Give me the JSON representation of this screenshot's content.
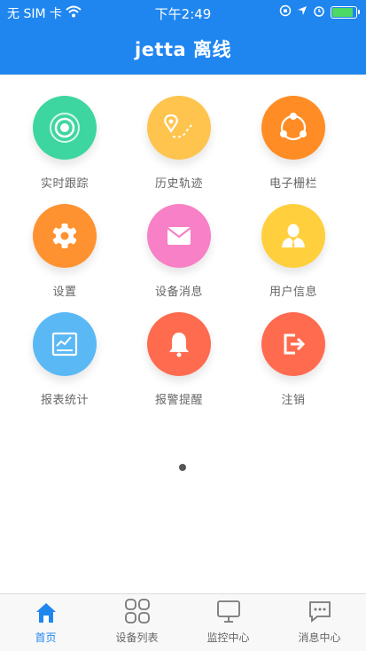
{
  "status_bar": {
    "carrier": "无 SIM 卡",
    "time": "下午2:49"
  },
  "header": {
    "title": "jetta 离线"
  },
  "menu": {
    "items": [
      {
        "label": "实时跟踪",
        "icon": "target-icon",
        "color": "#3ed6a0"
      },
      {
        "label": "历史轨迹",
        "icon": "location-track-icon",
        "color": "#ffc44d"
      },
      {
        "label": "电子栅栏",
        "icon": "share-nodes-icon",
        "color": "#ff8c25"
      },
      {
        "label": "设置",
        "icon": "gear-icon",
        "color": "#ff9230"
      },
      {
        "label": "设备消息",
        "icon": "envelope-icon",
        "color": "#f780c6"
      },
      {
        "label": "用户信息",
        "icon": "user-icon",
        "color": "#ffcf3d"
      },
      {
        "label": "报表统计",
        "icon": "report-chart-icon",
        "color": "#5ab8f5"
      },
      {
        "label": "报警提醒",
        "icon": "bell-icon",
        "color": "#ff6b4f"
      },
      {
        "label": "注销",
        "icon": "logout-icon",
        "color": "#ff6b4f"
      }
    ]
  },
  "tabbar": {
    "tabs": [
      {
        "label": "首页",
        "icon": "home-icon",
        "active": true
      },
      {
        "label": "设备列表",
        "icon": "grid-icon",
        "active": false
      },
      {
        "label": "监控中心",
        "icon": "monitor-icon",
        "active": false
      },
      {
        "label": "消息中心",
        "icon": "chat-icon",
        "active": false
      }
    ]
  },
  "colors": {
    "primary": "#1f86f0",
    "label_text": "#666666"
  }
}
